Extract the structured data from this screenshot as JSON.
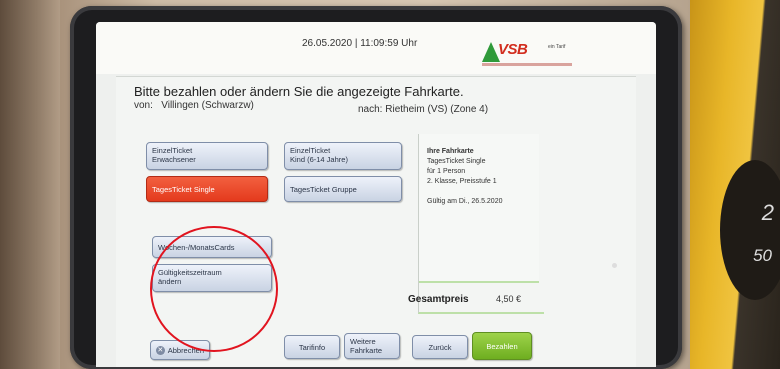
{
  "header": {
    "datetime": "26.05.2020 | 11:09:59 Uhr",
    "logo_text": "VSB",
    "logo_tag": "ein Tarif"
  },
  "page": {
    "headline": "Bitte bezahlen oder ändern Sie die angezeigte Fahrkarte.",
    "from_label": "von:",
    "from_value": "Villingen (Schwarzw)",
    "to_label": "nach:",
    "to_value": "Rietheim (VS) (Zone 4)"
  },
  "tickets": {
    "einzel_erwachsener_1": "EinzelTicket",
    "einzel_erwachsener_2": "Erwachsener",
    "einzel_kind_1": "EinzelTicket",
    "einzel_kind_2": "Kind (6-14 Jahre)",
    "tages_single": "TagesTicket Single",
    "tages_gruppe": "TagesTicket Gruppe",
    "wochen_monats": "Wochen-/MonatsCards",
    "gueltigkeit_1": "Gültigkeitszeitraum",
    "gueltigkeit_2": "ändern"
  },
  "info": {
    "title": "Ihre Fahrkarte",
    "line1": "TagesTicket Single",
    "line2": "für 1 Person",
    "line3": "2. Klasse, Preisstufe 1",
    "validity": "Gültig am Di., 26.5.2020"
  },
  "total": {
    "label": "Gesamtpreis",
    "value": "4,50 €"
  },
  "footer": {
    "cancel": "Abbrechen",
    "tarifinfo": "Tarifinfo",
    "weitere_1": "Weitere",
    "weitere_2": "Fahrkarte",
    "zurueck": "Zurück",
    "bezahlen": "Bezahlen"
  },
  "colors": {
    "active_ticket": "#e43a1d",
    "pay_button": "#6eae20",
    "annotation_circle": "#e1141f",
    "logo_red": "#d22d1e"
  },
  "housing": {
    "coin_label_1": "2",
    "coin_label_2": "50"
  }
}
